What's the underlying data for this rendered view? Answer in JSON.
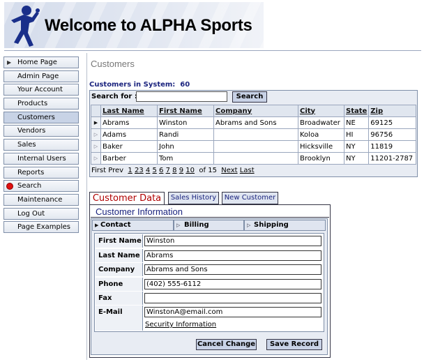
{
  "banner": {
    "title": "Welcome to ALPHA Sports"
  },
  "sidebar": {
    "items": [
      {
        "label": "Home Page"
      },
      {
        "label": "Admin Page"
      },
      {
        "label": "Your Account"
      },
      {
        "label": "Products"
      },
      {
        "label": "Customers"
      },
      {
        "label": "Vendors"
      },
      {
        "label": "Sales"
      },
      {
        "label": "Internal Users"
      },
      {
        "label": "Reports"
      },
      {
        "label": "Search"
      },
      {
        "label": "Maintenance"
      },
      {
        "label": "Log Out"
      },
      {
        "label": "Page Examples"
      }
    ]
  },
  "main": {
    "title": "Customers",
    "count_label": "Customers in System:",
    "count_value": "60",
    "search": {
      "label": "Search for :",
      "value": "",
      "button": "Search"
    },
    "grid": {
      "columns": [
        "Last Name",
        "First Name",
        "Company",
        "City",
        "State",
        "Zip"
      ],
      "rows": [
        [
          "Abrams",
          "Winston",
          "Abrams and Sons",
          "Broadwater",
          "NE",
          "69125"
        ],
        [
          "Adams",
          "Randi",
          "",
          "Koloa",
          "HI",
          "96756"
        ],
        [
          "Baker",
          "John",
          "",
          "Hicksville",
          "NY",
          "11819"
        ],
        [
          "Barber",
          "Tom",
          "",
          "Brooklyn",
          "NY",
          "11201-2787"
        ]
      ]
    },
    "pager": {
      "first": "First",
      "prev": "Prev",
      "pages": [
        "1",
        "2",
        "3",
        "4",
        "5",
        "6",
        "7",
        "8",
        "9",
        "10"
      ],
      "of_text": "of 15",
      "next": "Next",
      "last": "Last"
    }
  },
  "tabs": [
    {
      "label": "Customer Data"
    },
    {
      "label": "Sales History"
    },
    {
      "label": "New Customer"
    }
  ],
  "form": {
    "title": "Customer Information",
    "subtabs": [
      {
        "label": "Contact"
      },
      {
        "label": "Billing"
      },
      {
        "label": "Shipping"
      }
    ],
    "fields": [
      {
        "label": "First Name",
        "value": "Winston"
      },
      {
        "label": "Last Name",
        "value": "Abrams"
      },
      {
        "label": "Company",
        "value": "Abrams and Sons"
      },
      {
        "label": "Phone",
        "value": "(402) 555-6112"
      },
      {
        "label": "Fax",
        "value": ""
      },
      {
        "label": "E-Mail",
        "value": "WinstonA@email.com"
      }
    ],
    "security_link": "Security Information",
    "cancel_button": "Cancel Change",
    "save_button": "Save Record"
  },
  "colors": {
    "accent": "#1a237e",
    "active_tab_text": "#b00000",
    "search_dot": "#e01010"
  }
}
